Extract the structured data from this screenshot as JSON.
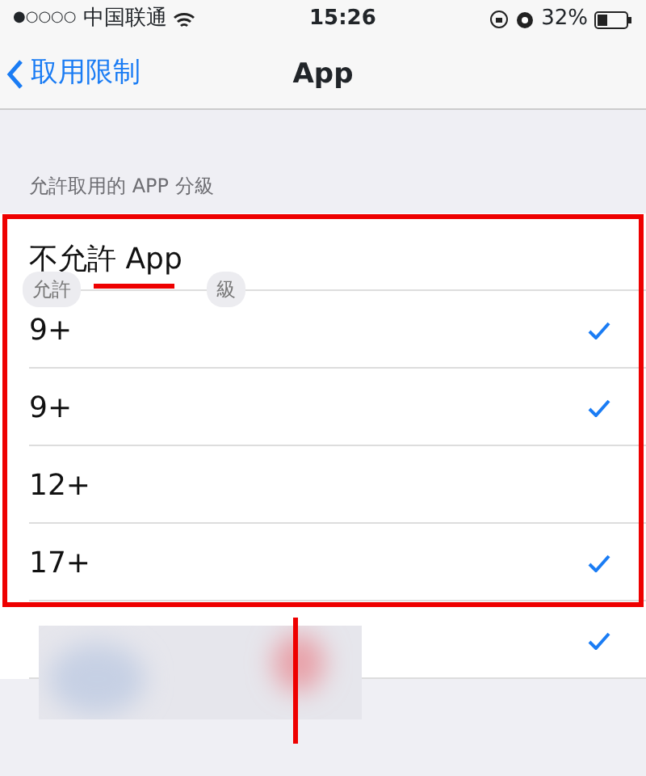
{
  "status_bar": {
    "signal": "●○○○○",
    "carrier": "中国联通",
    "time": "15:26",
    "battery": "32%"
  },
  "nav": {
    "back": "取用限制",
    "title": "App"
  },
  "section_header": "允許取用的 APP 分級",
  "rows": [
    {
      "label": "不允許 App",
      "checked": false
    },
    {
      "label": "9+",
      "checked": true
    },
    {
      "label": "9+",
      "checked": true
    },
    {
      "label": "12+",
      "checked": false
    },
    {
      "label": "17+",
      "checked": true
    },
    {
      "checked": true
    }
  ],
  "bubble": {
    "left": "允許",
    "right": "級"
  },
  "annotation": {
    "highlight_box": true,
    "arrow": true,
    "blurred_patch": true
  }
}
